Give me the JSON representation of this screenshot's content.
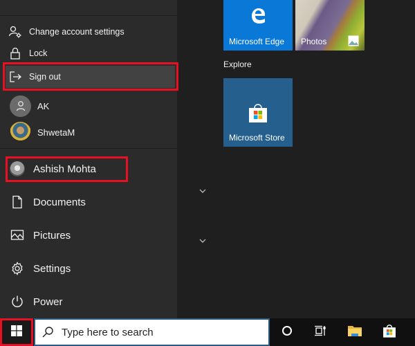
{
  "account_menu": {
    "items": [
      {
        "icon": "account-settings-icon",
        "label": "Change account settings"
      },
      {
        "icon": "lock-icon",
        "label": "Lock"
      },
      {
        "icon": "sign-out-icon",
        "label": "Sign out"
      }
    ],
    "other_users": [
      {
        "avatar": "default-avatar",
        "name": "AK"
      },
      {
        "avatar": "photo-avatar",
        "name": "ShwetaM"
      }
    ]
  },
  "nav": {
    "current_user": "Ashish Mohta",
    "items": [
      {
        "icon": "document-icon",
        "label": "Documents"
      },
      {
        "icon": "pictures-icon",
        "label": "Pictures"
      },
      {
        "icon": "gear-icon",
        "label": "Settings"
      },
      {
        "icon": "power-icon",
        "label": "Power"
      }
    ]
  },
  "tiles": {
    "group_label": "Explore",
    "items": [
      {
        "name": "Microsoft Edge",
        "color": "#0a78d7"
      },
      {
        "name": "Photos"
      },
      {
        "name": "Microsoft Store",
        "color": "#245f8d"
      }
    ]
  },
  "taskbar": {
    "search_placeholder": "Type here to search",
    "icons": [
      "cortana-icon",
      "task-view-icon",
      "file-explorer-icon",
      "store-icon"
    ]
  },
  "highlights": {
    "color": "#e81123",
    "targets": [
      "sign-out",
      "current-user",
      "start-button"
    ]
  }
}
